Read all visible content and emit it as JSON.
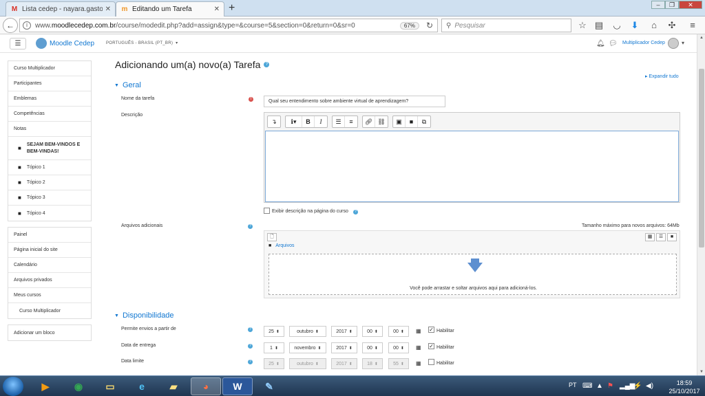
{
  "browser": {
    "tabs": [
      {
        "label": "Lista cedep - nayara.gaston@",
        "icon": "gmail-icon"
      },
      {
        "label": "Editando um Tarefa",
        "icon": "moodle-icon"
      }
    ],
    "url_prefix": "www.",
    "url_domain": "moodlecedep.com.br",
    "url_path": "/course/modedit.php?add=assign&type=&course=5&section=0&return=0&sr=0",
    "zoom": "67%",
    "search_placeholder": "Pesquisar"
  },
  "header": {
    "site_name": "Moodle Cedep",
    "language": "PORTUGUÊS - BRASIL (PT_BR) ‎",
    "language_caret": "▾",
    "user_name": "Multiplicador Cedep",
    "user_caret": "▾"
  },
  "sidebar": {
    "group1": [
      "Curso Multiplicador",
      "Participantes",
      "Emblemas",
      "Competências",
      "Notas"
    ],
    "topics": [
      "SEJAM BEM-VINDOS E BEM-VINDAS!",
      "Tópico 1",
      "Tópico 2",
      "Tópico 3",
      "Tópico 4"
    ],
    "group2": [
      "Painel",
      "Página inicial do site",
      "Calendário",
      "Arquivos privados",
      "Meus cursos",
      "Curso Multiplicador"
    ],
    "add_block": "Adicionar um bloco"
  },
  "main": {
    "page_title": "Adicionando um(a) novo(a) Tarefa",
    "expand_all": "Expandir tudo",
    "section_general": "Geral",
    "task_name_label": "Nome da tarefa",
    "task_name_value": "Qual seu entendimento sobre ambiente virtual de aprendizagem?",
    "description_label": "Descrição",
    "show_description_label": "Exibir descrição na página do curso",
    "additional_files_label": "Arquivos adicionais",
    "max_size": "Tamanho máximo para novos arquivos: 64Mb",
    "files_folder": "Arquivos",
    "drop_text": "Você pode arrastar e soltar arquivos aqui para adicioná-los.",
    "section_availability": "Disponibilidade",
    "enable_label": "Habilitar",
    "dates": [
      {
        "label": "Permite envios a partir de",
        "day": "25",
        "month": "outubro",
        "year": "2017",
        "hour": "00",
        "minute": "00",
        "enabled": true
      },
      {
        "label": "Data de entrega",
        "day": "1",
        "month": "novembro",
        "year": "2017",
        "hour": "00",
        "minute": "00",
        "enabled": true
      },
      {
        "label": "Data limite",
        "day": "25",
        "month": "outubro",
        "year": "2017",
        "hour": "18",
        "minute": "55",
        "enabled": false
      }
    ]
  },
  "taskbar": {
    "lang": "PT",
    "time": "18:59",
    "date": "25/10/2017"
  }
}
